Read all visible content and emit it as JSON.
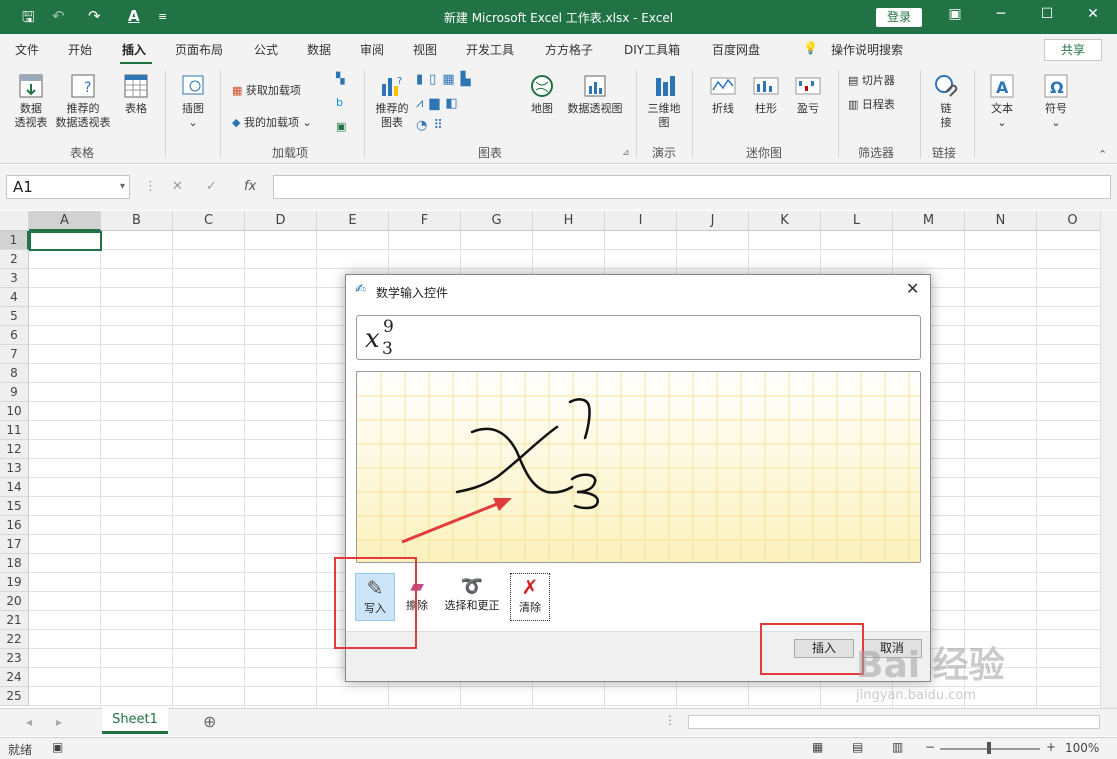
{
  "window": {
    "title": "新建 Microsoft Excel 工作表.xlsx  -  Excel",
    "login": "登录",
    "share": "共享"
  },
  "tabs": [
    "文件",
    "开始",
    "插入",
    "页面布局",
    "公式",
    "数据",
    "审阅",
    "视图",
    "开发工具",
    "方方格子",
    "DIY工具箱",
    "百度网盘",
    "操作说明搜索"
  ],
  "ribbon": {
    "pivot": "数据\n透视表",
    "rec_pivot": "推荐的\n数据透视表",
    "table": "表格",
    "illus": "插图",
    "get_addins": "获取加载项",
    "my_addins": "我的加载项",
    "rec_chart": "推荐的\n图表",
    "map": "地图",
    "pivot_chart": "数据透视图",
    "map3d": "三维地\n图",
    "line": "折线",
    "column": "柱形",
    "winloss": "盈亏",
    "slicer": "切片器",
    "timeline": "日程表",
    "link": "链\n接",
    "text": "文本",
    "symbol": "符号",
    "groups": {
      "tables": "表格",
      "addins": "加载项",
      "charts": "图表",
      "tours": "演示",
      "sparklines": "迷你图",
      "filters": "筛选器",
      "links": "链接"
    }
  },
  "formula": {
    "cell": "A1",
    "fx": "fx"
  },
  "columns": [
    "A",
    "B",
    "C",
    "D",
    "E",
    "F",
    "G",
    "H",
    "I",
    "J",
    "K",
    "L",
    "M",
    "N",
    "O"
  ],
  "rows": [
    "1",
    "2",
    "3",
    "4",
    "5",
    "6",
    "7",
    "8",
    "9",
    "10",
    "11",
    "12",
    "13",
    "14",
    "15",
    "16",
    "17",
    "18",
    "19",
    "20",
    "21",
    "22",
    "23",
    "24",
    "25"
  ],
  "sheet": {
    "name": "Sheet1"
  },
  "status": {
    "ready": "就绪",
    "zoom": "100%"
  },
  "dialog": {
    "title": "数学输入控件",
    "preview": {
      "base": "x",
      "sup": "9",
      "sub": "3"
    },
    "tools": [
      "写入",
      "擦除",
      "选择和更正",
      "清除"
    ],
    "insert": "插入",
    "cancel": "取消"
  },
  "watermark": "Bai 经验",
  "watermark_url": "jingyan.baidu.com",
  "colors": {
    "excel_green": "#217346",
    "highlight_red": "#e23b3b"
  }
}
